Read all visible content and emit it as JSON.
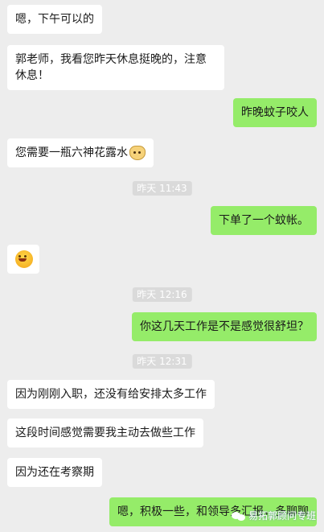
{
  "messages": [
    {
      "side": "left",
      "text": "嗯，下午可以的"
    },
    {
      "side": "left",
      "text": "郭老师，我看您昨天休息挺晚的，注意休息！"
    },
    {
      "side": "right",
      "text": "昨晚蚊子咬人"
    },
    {
      "side": "left",
      "text": "您需要一瓶六神花露水",
      "emoji": "cat-face-icon"
    },
    {
      "side": "right",
      "text": "下单了一个蚊帐。"
    },
    {
      "side": "left",
      "emoji": "grinning-face-icon"
    },
    {
      "side": "right",
      "text": "你这几天工作是不是感觉很舒坦？"
    },
    {
      "side": "left",
      "text": "因为刚刚入职，还没有给安排太多工作"
    },
    {
      "side": "left",
      "text": "这段时间感觉需要我主动去做些工作"
    },
    {
      "side": "left",
      "text": "因为还在考察期"
    },
    {
      "side": "right",
      "text": "嗯，积极一些，和领导多汇报，多聊聊"
    }
  ],
  "timestamps": [
    "昨天 11:43",
    "昨天 12:16",
    "昨天 12:31"
  ],
  "watermark": {
    "text": "易拓郭顾问专班",
    "icon": "wechat-icon"
  },
  "colors": {
    "background": "#ededed",
    "left_bubble": "#ffffff",
    "right_bubble": "#95ec69",
    "timestamp_bg": "#dadada"
  }
}
